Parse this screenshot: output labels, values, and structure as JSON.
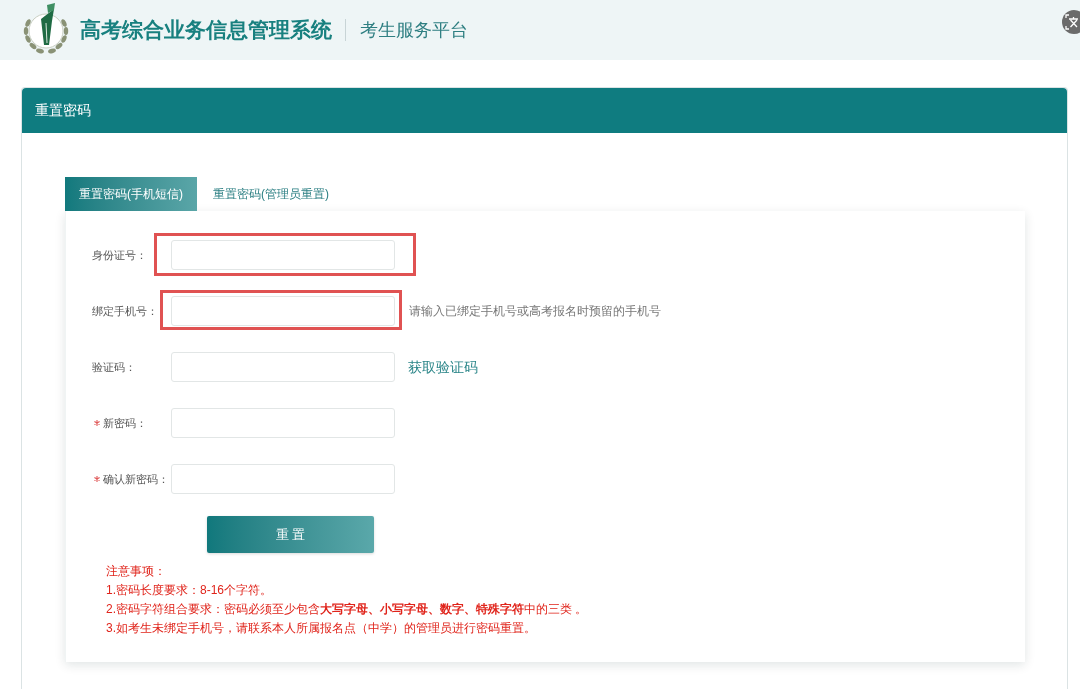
{
  "header": {
    "title": "高考综合业务信息管理系统",
    "subtitle": "考生服务平台"
  },
  "panel": {
    "title": "重置密码"
  },
  "tabs": [
    {
      "label": "重置密码(手机短信)",
      "selected": true
    },
    {
      "label": "重置密码(管理员重置)",
      "selected": false
    }
  ],
  "form": {
    "fields": [
      {
        "label": "身份证号：",
        "required": false,
        "highlighted": true
      },
      {
        "label": "绑定手机号：",
        "required": false,
        "highlighted": true,
        "hint": "请输入已绑定手机号或高考报名时预留的手机号"
      },
      {
        "label": "验证码：",
        "required": false,
        "highlighted": false,
        "action_link": "获取验证码"
      },
      {
        "label": "新密码：",
        "required": true,
        "highlighted": false
      },
      {
        "label": "确认新密码：",
        "required": true,
        "highlighted": false
      }
    ],
    "submit_button": "重 置"
  },
  "notes": {
    "title": "注意事项：",
    "items": [
      "1.密码长度要求：8-16个字符。",
      "2.密码字符组合要求：密码必须至少包含**大写字母、小写字母、数字、特殊字符**中的三类 。",
      "3.如考生未绑定手机号，请联系本人所属报名点（中学）的管理员进行密码重置。"
    ]
  }
}
